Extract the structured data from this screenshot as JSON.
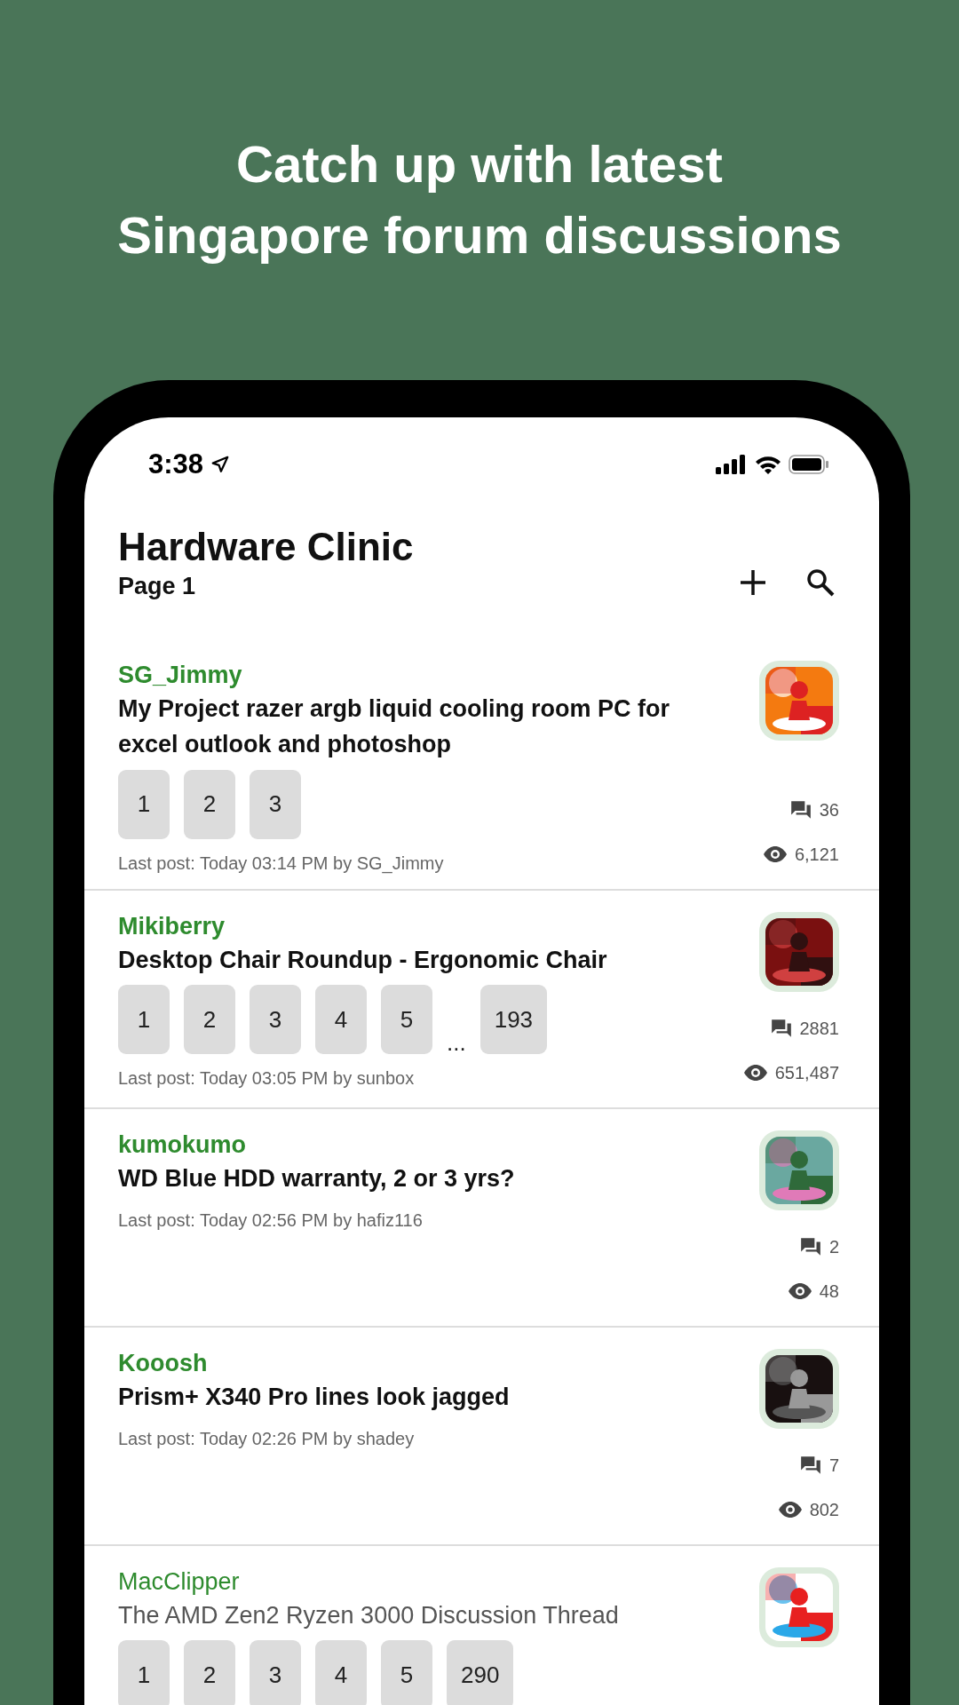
{
  "headline": [
    "Catch up with latest",
    "Singapore forum discussions"
  ],
  "status_bar": {
    "time": "3:38"
  },
  "header": {
    "title": "Hardware Clinic",
    "subtitle": "Page 1"
  },
  "threads": [
    {
      "author": "SG_Jimmy",
      "title": "My Project razer argb liquid cooling room PC for excel outlook and photoshop",
      "unread": true,
      "pages": [
        {
          "kind": "page",
          "label": "1"
        },
        {
          "kind": "page",
          "label": "2"
        },
        {
          "kind": "page",
          "label": "3"
        }
      ],
      "last_post": "Last post: Today 03:14 PM by SG_Jimmy",
      "replies": "36",
      "views": "6,121"
    },
    {
      "author": "Mikiberry",
      "title": "Desktop Chair Roundup - Ergonomic Chair",
      "unread": true,
      "pages": [
        {
          "kind": "page",
          "label": "1"
        },
        {
          "kind": "page",
          "label": "2"
        },
        {
          "kind": "page",
          "label": "3"
        },
        {
          "kind": "page",
          "label": "4"
        },
        {
          "kind": "page",
          "label": "5"
        },
        {
          "kind": "gap",
          "label": "..."
        },
        {
          "kind": "page",
          "label": "193"
        }
      ],
      "last_post": "Last post: Today 03:05 PM by sunbox",
      "replies": "2881",
      "views": "651,487"
    },
    {
      "author": "kumokumo",
      "title": "WD Blue HDD warranty, 2 or 3 yrs?",
      "unread": true,
      "last_post": "Last post: Today 02:56 PM by hafiz116",
      "replies": "2",
      "views": "48"
    },
    {
      "author": "Kooosh",
      "title": "Prism+ X340 Pro lines look jagged",
      "unread": true,
      "last_post": "Last post: Today 02:26 PM by shadey",
      "replies": "7",
      "views": "802"
    },
    {
      "author": "MacClipper",
      "title": "The AMD Zen2 Ryzen 3000 Discussion Thread",
      "unread": false,
      "pages": [
        {
          "kind": "page",
          "label": "1"
        },
        {
          "kind": "page",
          "label": "2"
        },
        {
          "kind": "page",
          "label": "3"
        },
        {
          "kind": "page",
          "label": "4"
        },
        {
          "kind": "page",
          "label": "5"
        },
        {
          "kind": "page",
          "label": "290"
        }
      ]
    }
  ]
}
